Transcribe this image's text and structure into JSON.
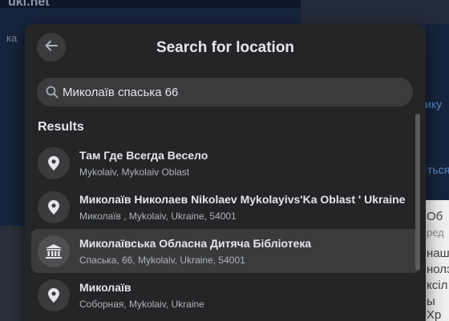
{
  "background": {
    "logo": "uki.net",
    "left_text": "ка",
    "right_links": [
      "ику",
      "ться"
    ],
    "right_dark_text": [
      "Об",
      "ред"
    ],
    "right_gray_text": [
      "наш",
      "нолэ",
      "ксіл",
      "юИ",
      "ы Хр"
    ]
  },
  "modal": {
    "title": "Search for location",
    "search": {
      "value": "Миколаїв спаська 66",
      "placeholder": ""
    },
    "results_label": "Results",
    "results": [
      {
        "title": "Там Где Всегда Весело",
        "subtitle": "Mykolaiv, Mykolaiv Oblast",
        "icon": "map-pin-icon"
      },
      {
        "title": "Миколаїв Николаев Nikolaev Mykolayivs'Ka Oblast ' Ukraine",
        "subtitle": "Миколаїв , Mykolaiv, Ukraine, 54001",
        "icon": "map-pin-icon"
      },
      {
        "title": "Миколаївська Обласна Дитяча Бібліотека",
        "subtitle": "Спаська, 66, Mykolaiv, Ukraine, 54001",
        "icon": "library-icon"
      },
      {
        "title": "Миколаїв",
        "subtitle": "Соборная, Mykolaiv, Ukraine",
        "icon": "map-pin-icon"
      }
    ]
  },
  "colors": {
    "modal_bg": "#242526",
    "input_bg": "#3a3b3c",
    "text_primary": "#e4e6eb",
    "text_secondary": "#b0b3b8"
  }
}
